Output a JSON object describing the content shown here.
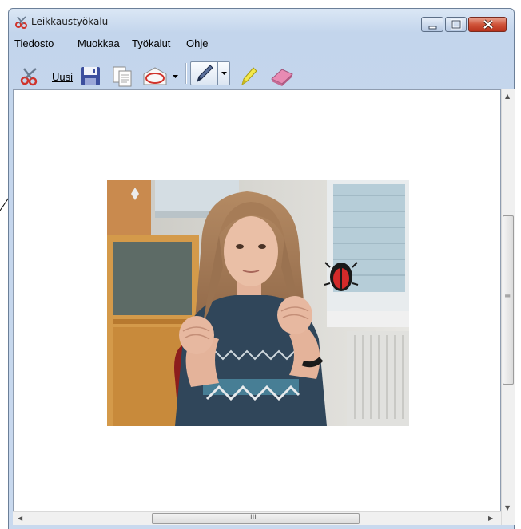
{
  "window": {
    "title": "Leikkaustyökalu",
    "accent_color": "#c3d5ec",
    "close_color": "#c8452d"
  },
  "menubar": {
    "file": "Tiedosto",
    "edit": "Muokkaa",
    "tools": "Työkalut",
    "help": "Ohje"
  },
  "toolbar": {
    "new_label": "Uusi",
    "icons": [
      "scissors-icon",
      "save-icon",
      "copy-icon",
      "send-snip-icon",
      "pen-icon",
      "highlighter-icon",
      "eraser-icon"
    ]
  },
  "canvas": {
    "content": "screen-capture-photo",
    "background": "#ffffff"
  },
  "scrollbars": {
    "grip": "≡",
    "h_grip": "III"
  }
}
